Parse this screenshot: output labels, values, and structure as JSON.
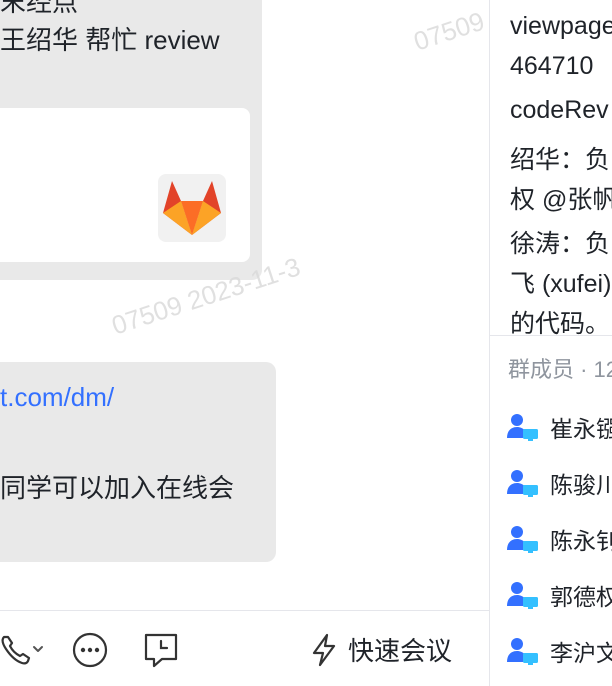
{
  "chat": {
    "message_top_fragment": "末经点",
    "message_line": "王绍华 帮忙 review",
    "watermark_1": "07509",
    "watermark_2": "07509 2023-11-3",
    "link_fragment": "t.com/dm/",
    "message2_line": "同学可以加入在线会"
  },
  "toolbar": {
    "quick_meeting_label": "快速会议"
  },
  "side_panel": {
    "lines": [
      "viewpage",
      "464710",
      "codeRev",
      "绍华：负",
      "权 @张帆",
      "徐涛：负",
      "飞 (xufei)",
      "的代码。"
    ],
    "members_title": "群成员 · 12",
    "members": [
      "崔永镪",
      "陈骏川",
      "陈永钊",
      "郭德权",
      "李沪文"
    ]
  },
  "colors": {
    "bubble": "#e9e9e9",
    "link": "#3370ff",
    "member_icon": "#3370ff"
  }
}
